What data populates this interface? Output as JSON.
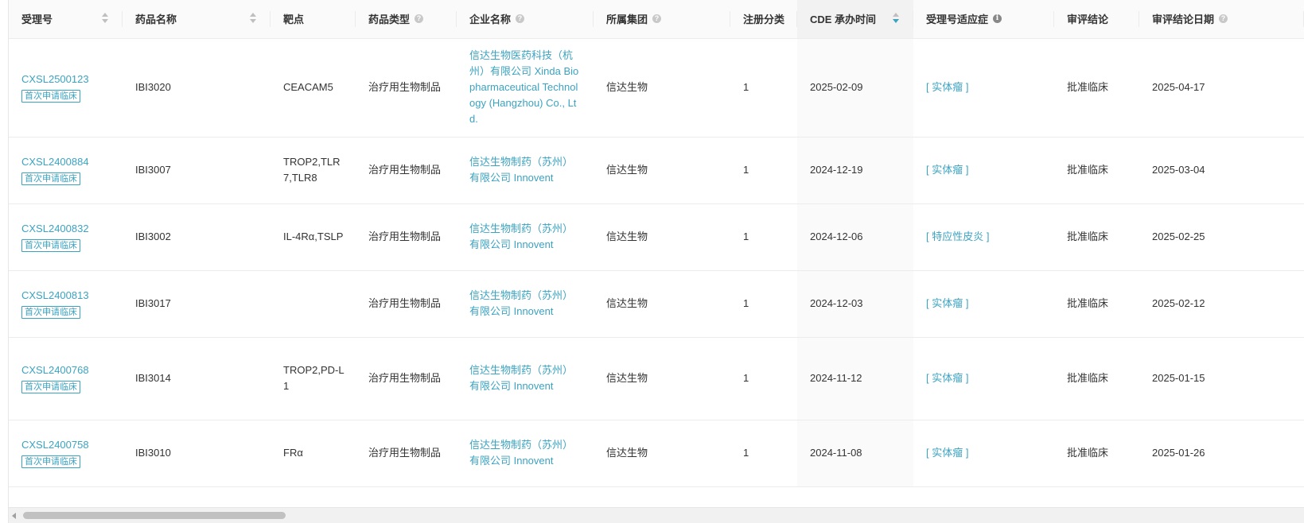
{
  "columns": [
    {
      "label": "受理号",
      "icon": "sort-icon"
    },
    {
      "label": "药品名称",
      "icon": "sort-icon"
    },
    {
      "label": "靶点"
    },
    {
      "label": "药品类型",
      "icon": "help-icon"
    },
    {
      "label": "企业名称",
      "icon": "help-icon"
    },
    {
      "label": "所属集团",
      "icon": "help-icon"
    },
    {
      "label": "注册分类"
    },
    {
      "label": "CDE 承办时间",
      "icon": "sort-icon",
      "sort": "desc"
    },
    {
      "label": "受理号适应症",
      "icon": "info-icon"
    },
    {
      "label": "审评结论"
    },
    {
      "label": "审评结论日期",
      "icon": "help-icon"
    }
  ],
  "rows": [
    {
      "accept_no": "CXSL2500123",
      "tag": "首次申请临床",
      "drug": "IBI3020",
      "target": "CEACAM5",
      "drug_type": "治疗用生物制品",
      "company": "信达生物医药科技（杭州）有限公司 Xinda Biopharmaceutical Technology (Hangzhou) Co., Ltd.",
      "group": "信达生物",
      "reg_class": "1",
      "cde_date": "2025-02-09",
      "indication": "[ 实体瘤 ]",
      "conclusion": "批准临床",
      "conclusion_date": "2025-04-17"
    },
    {
      "accept_no": "CXSL2400884",
      "tag": "首次申请临床",
      "drug": "IBI3007",
      "target": "TROP2,TLR7,TLR8",
      "drug_type": "治疗用生物制品",
      "company": "信达生物制药（苏州）有限公司 Innovent",
      "group": "信达生物",
      "reg_class": "1",
      "cde_date": "2024-12-19",
      "indication": "[ 实体瘤 ]",
      "conclusion": "批准临床",
      "conclusion_date": "2025-03-04"
    },
    {
      "accept_no": "CXSL2400832",
      "tag": "首次申请临床",
      "drug": "IBI3002",
      "target": "IL-4Rα,TSLP",
      "drug_type": "治疗用生物制品",
      "company": "信达生物制药（苏州）有限公司 Innovent",
      "group": "信达生物",
      "reg_class": "1",
      "cde_date": "2024-12-06",
      "indication": "[ 特应性皮炎 ]",
      "conclusion": "批准临床",
      "conclusion_date": "2025-02-25"
    },
    {
      "accept_no": "CXSL2400813",
      "tag": "首次申请临床",
      "drug": "IBI3017",
      "target": "",
      "drug_type": "治疗用生物制品",
      "company": "信达生物制药（苏州）有限公司 Innovent",
      "group": "信达生物",
      "reg_class": "1",
      "cde_date": "2024-12-03",
      "indication": "[ 实体瘤 ]",
      "conclusion": "批准临床",
      "conclusion_date": "2025-02-12"
    },
    {
      "accept_no": "CXSL2400768",
      "tag": "首次申请临床",
      "drug": "IBI3014",
      "target": "TROP2,PD-L1",
      "drug_type": "治疗用生物制品",
      "company": "信达生物制药（苏州）有限公司 Innovent",
      "group": "信达生物",
      "reg_class": "1",
      "cde_date": "2024-11-12",
      "indication": "[ 实体瘤 ]",
      "conclusion": "批准临床",
      "conclusion_date": "2025-01-15"
    },
    {
      "accept_no": "CXSL2400758",
      "tag": "首次申请临床",
      "drug": "IBI3010",
      "target": "FRα",
      "drug_type": "治疗用生物制品",
      "company": "信达生物制药（苏州）有限公司 Innovent",
      "group": "信达生物",
      "reg_class": "1",
      "cde_date": "2024-11-08",
      "indication": "[ 实体瘤 ]",
      "conclusion": "批准临床",
      "conclusion_date": "2025-01-26"
    }
  ],
  "colors": {
    "link": "#3ba3c1",
    "header_bg": "#fafafa",
    "sorted_bg": "#f2f2f2",
    "border": "#ececec"
  }
}
